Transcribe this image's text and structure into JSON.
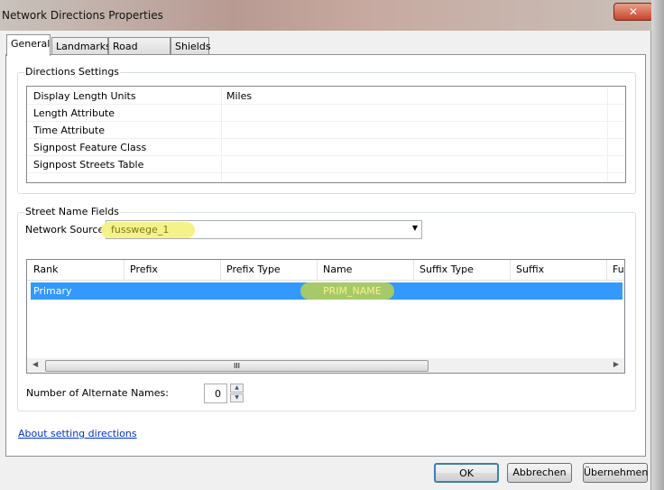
{
  "window": {
    "title": "Network Directions Properties",
    "close_icon": "close-icon"
  },
  "tabs": [
    {
      "label": "General",
      "active": true
    },
    {
      "label": "Landmarks"
    },
    {
      "label": "Road Detail"
    },
    {
      "label": "Shields"
    }
  ],
  "directions_settings": {
    "title": "Directions Settings",
    "rows": [
      {
        "name": "Display Length Units",
        "value": "Miles"
      },
      {
        "name": "Length Attribute",
        "value": ""
      },
      {
        "name": "Time Attribute",
        "value": ""
      },
      {
        "name": "Signpost Feature Class",
        "value": ""
      },
      {
        "name": "Signpost Streets Table",
        "value": ""
      }
    ]
  },
  "street_name_fields": {
    "title": "Street Name Fields",
    "network_source_label": "Network Source:",
    "network_source_value": "fusswege_1",
    "columns": [
      "Rank",
      "Prefix",
      "Prefix Type",
      "Name",
      "Suffix Type",
      "Suffix",
      "Fu"
    ],
    "rows": [
      {
        "rank": "Primary",
        "prefix": "",
        "prefix_type": "",
        "name": "PRIM_NAME",
        "suffix_type": "",
        "suffix": ""
      }
    ],
    "alternate_names_label": "Number of Alternate Names:",
    "alternate_names_value": "0"
  },
  "link": "About setting directions",
  "buttons": {
    "ok": "OK",
    "cancel": "Abbrechen",
    "apply": "Übernehmen"
  },
  "colors": {
    "selection": "#3399ff",
    "highlight_yellow": "#f6f28a",
    "highlight_green": "#a6c96a"
  }
}
